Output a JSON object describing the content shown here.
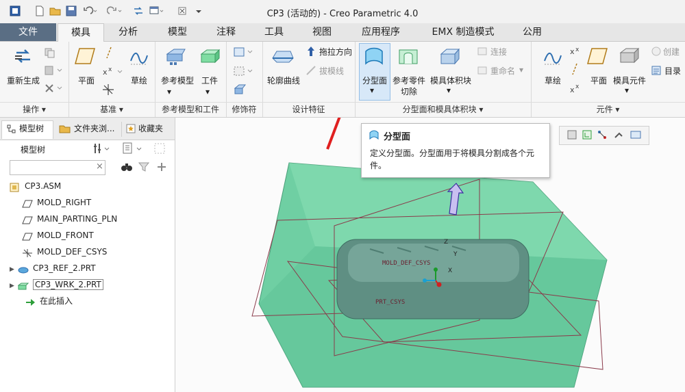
{
  "window_title": "CP3 (活动的) - Creo Parametric 4.0",
  "tabs": [
    {
      "label": "文件"
    },
    {
      "label": "模具"
    },
    {
      "label": "分析"
    },
    {
      "label": "模型"
    },
    {
      "label": "注释"
    },
    {
      "label": "工具"
    },
    {
      "label": "视图"
    },
    {
      "label": "应用程序"
    },
    {
      "label": "EMX 制造模式"
    },
    {
      "label": "公用"
    }
  ],
  "ribbon": {
    "groups": [
      {
        "label": "操作 ▾"
      },
      {
        "label": "基准 ▾"
      },
      {
        "label": "参考模型和工件"
      },
      {
        "label": "修饰符"
      },
      {
        "label": "设计特征"
      },
      {
        "label": "分型面和模具体积块 ▾"
      },
      {
        "label": "元件 ▾"
      }
    ],
    "regenerate": "重新生成",
    "plane": "平面",
    "sketch": "草绘",
    "ref_model": "参考模型",
    "workpiece": "工件",
    "silhouette_curve": "轮廓曲线",
    "drag_direction": "拖拉方向",
    "draft_line": "拔模线",
    "parting_surface": "分型面",
    "ref_part_cutout_l1": "参考零件",
    "ref_part_cutout_l2": "切除",
    "mold_volume": "模具体积块",
    "connect": "连接",
    "rename": "重命名",
    "sketch2": "草绘",
    "plane2": "平面",
    "mold_component": "模具元件",
    "create": "创建",
    "catalog": "目录"
  },
  "tooltip": {
    "title": "分型面",
    "body": "定义分型面。分型面用于将模具分割成各个元件。"
  },
  "left_panel": {
    "tabs": [
      {
        "label": "模型树"
      },
      {
        "label": "文件夹浏..."
      },
      {
        "label": "收藏夹"
      }
    ],
    "header": "模型树",
    "search_placeholder": "",
    "tree": [
      {
        "label": "CP3.ASM"
      },
      {
        "label": "MOLD_RIGHT"
      },
      {
        "label": "MAIN_PARTING_PLN"
      },
      {
        "label": "MOLD_FRONT"
      },
      {
        "label": "MOLD_DEF_CSYS"
      },
      {
        "label": "CP3_REF_2.PRT"
      },
      {
        "label": "CP3_WRK_2.PRT"
      },
      {
        "label": "在此插入"
      }
    ]
  },
  "graphics": {
    "label_csys": "MOLD_DEF_CSYS",
    "label_prt": "PRT_CSYS",
    "axis_x": "X",
    "axis_y": "Y",
    "axis_z": "Z"
  },
  "colors": {
    "workpiece": "#6fcfa3",
    "part": "#5f8f83",
    "accent_tab": "#5a6e84",
    "arrow": "#e02020"
  }
}
